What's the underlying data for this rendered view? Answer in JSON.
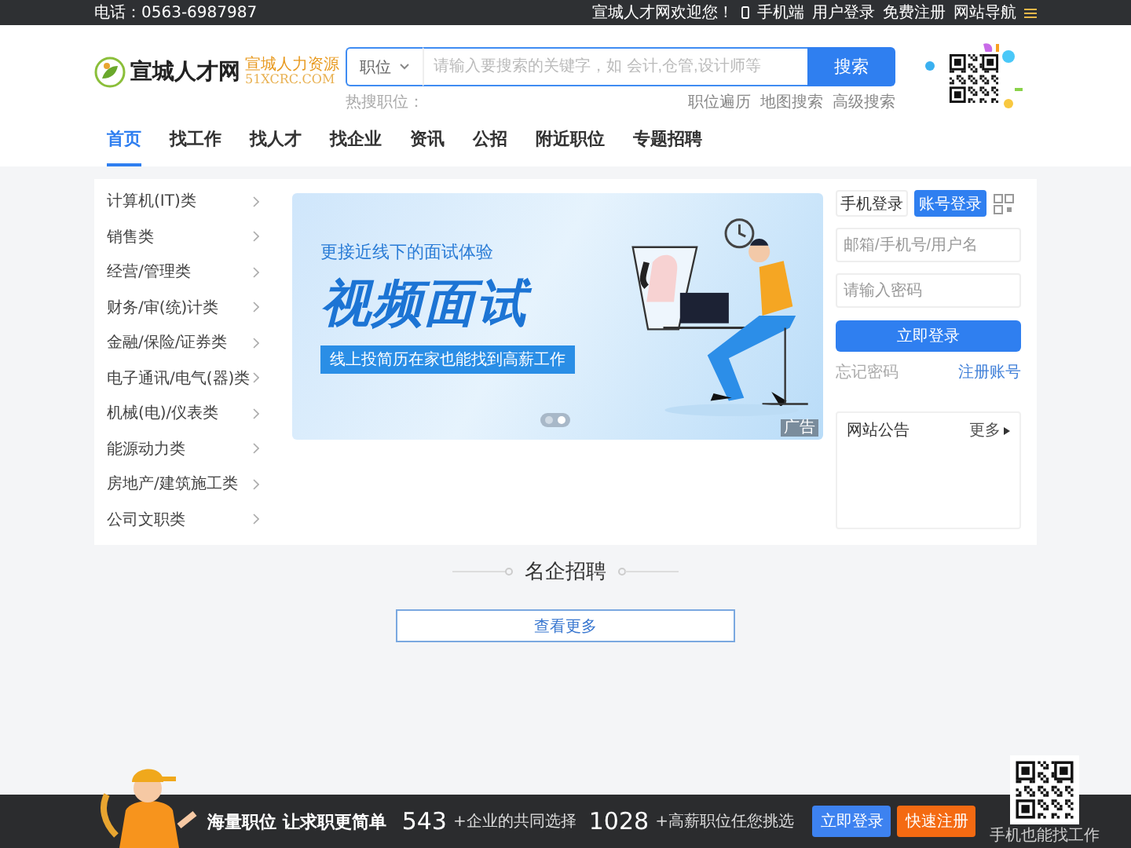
{
  "top_bar": {
    "phone": "电话：0563-6987987",
    "welcome": "宣城人才网欢迎您！",
    "links": [
      {
        "label": "手机端",
        "kind": "mobile"
      },
      {
        "label": "用户登录",
        "kind": "plain"
      },
      {
        "label": "免费注册",
        "kind": "plain"
      },
      {
        "label": "网站导航",
        "kind": "menu"
      }
    ]
  },
  "logo": {
    "name": "宣城人才网",
    "tagline": "宣城人力资源",
    "domain": "51XCRC.COM"
  },
  "search": {
    "category": "职位",
    "placeholder": "请输入要搜索的关键字，如 会计,仓管,设计师等",
    "button": "搜索",
    "hot_label": "热搜职位：",
    "links": [
      "职位遍历",
      "地图搜索",
      "高级搜索"
    ]
  },
  "nav": [
    {
      "label": "首页",
      "selected": true
    },
    {
      "label": "找工作",
      "selected": false
    },
    {
      "label": "找人才",
      "selected": false
    },
    {
      "label": "找企业",
      "selected": false
    },
    {
      "label": "资讯",
      "selected": false
    },
    {
      "label": "公招",
      "selected": false
    },
    {
      "label": "附近职位",
      "selected": false
    },
    {
      "label": "专题招聘",
      "selected": false
    }
  ],
  "categories": [
    "计算机(IT)类",
    "销售类",
    "经营/管理类",
    "财务/审(统)计类",
    "金融/保险/证券类",
    "电子通讯/电气(器)类",
    "机械(电)/仪表类",
    "能源动力类",
    "房地产/建筑施工类",
    "公司文职类"
  ],
  "banner": {
    "subtitle": "更接近线下的面试体验",
    "title": "视频面试",
    "slogan": "线上投简历在家也能找到高薪工作",
    "ad_tag": "广告",
    "slides": [
      {
        "selected": false
      },
      {
        "selected": true
      }
    ]
  },
  "login": {
    "tabs": [
      {
        "label": "手机登录",
        "selected": false
      },
      {
        "label": "账号登录",
        "selected": true
      }
    ],
    "fields": [
      {
        "placeholder": "邮箱/手机号/用户名"
      },
      {
        "placeholder": "请输入密码"
      }
    ],
    "button": "立即登录",
    "forgot": "忘记密码",
    "register": "注册账号"
  },
  "notice": {
    "title": "网站公告",
    "more": "更多"
  },
  "companies": {
    "title": "名企招聘",
    "more_button": "查看更多"
  },
  "footer_bar": {
    "slogan": "海量职位 让求职更简单",
    "stats": [
      {
        "number": "543",
        "caption": "+企业的共同选择"
      },
      {
        "number": "1028",
        "caption": "+高薪职位任您挑选"
      }
    ],
    "buttons": [
      {
        "label": "立即登录",
        "kind": "primary"
      },
      {
        "label": "快速注册",
        "kind": "accent"
      }
    ],
    "qr_caption": "手机也能找工作"
  }
}
